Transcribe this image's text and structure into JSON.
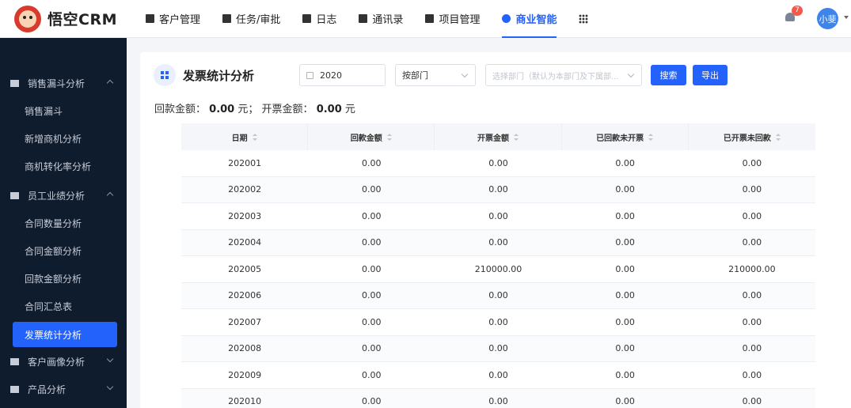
{
  "app": {
    "brand": "悟空CRM"
  },
  "nav": {
    "items": [
      {
        "label": "客户管理"
      },
      {
        "label": "任务/审批"
      },
      {
        "label": "日志"
      },
      {
        "label": "通讯录"
      },
      {
        "label": "项目管理"
      },
      {
        "label": "商业智能",
        "active": true
      }
    ],
    "notifications": "7",
    "user": "小斐"
  },
  "sidebar": {
    "groups": [
      {
        "label": "销售漏斗分析",
        "expanded": true,
        "items": [
          "销售漏斗",
          "新增商机分析",
          "商机转化率分析"
        ]
      },
      {
        "label": "员工业绩分析",
        "expanded": true,
        "items": [
          "合同数量分析",
          "合同金额分析",
          "回款金额分析",
          "合同汇总表",
          "发票统计分析"
        ]
      },
      {
        "label": "客户画像分析",
        "expanded": false
      },
      {
        "label": "产品分析",
        "expanded": false
      }
    ],
    "active_item": "发票统计分析"
  },
  "page": {
    "title": "发票统计分析",
    "year": "2020",
    "group_by": "按部门",
    "dept_placeholder": "选择部门（默认为本部门及下属部...",
    "search_label": "搜索",
    "export_label": "导出",
    "summary": {
      "received_label": "回款金额：",
      "received_value": "0.00",
      "unit1": "元；",
      "invoiced_label": "开票金额：",
      "invoiced_value": "0.00",
      "unit2": "元"
    }
  },
  "table": {
    "columns": [
      "日期",
      "回款金额",
      "开票金额",
      "已回款未开票",
      "已开票未回款"
    ],
    "rows": [
      [
        "202001",
        "0.00",
        "0.00",
        "0.00",
        "0.00"
      ],
      [
        "202002",
        "0.00",
        "0.00",
        "0.00",
        "0.00"
      ],
      [
        "202003",
        "0.00",
        "0.00",
        "0.00",
        "0.00"
      ],
      [
        "202004",
        "0.00",
        "0.00",
        "0.00",
        "0.00"
      ],
      [
        "202005",
        "0.00",
        "210000.00",
        "0.00",
        "210000.00"
      ],
      [
        "202006",
        "0.00",
        "0.00",
        "0.00",
        "0.00"
      ],
      [
        "202007",
        "0.00",
        "0.00",
        "0.00",
        "0.00"
      ],
      [
        "202008",
        "0.00",
        "0.00",
        "0.00",
        "0.00"
      ],
      [
        "202009",
        "0.00",
        "0.00",
        "0.00",
        "0.00"
      ],
      [
        "202010",
        "0.00",
        "0.00",
        "0.00",
        "0.00"
      ]
    ]
  },
  "colors": {
    "accent": "#2362fb",
    "sidebar_bg": "#0f1c2e",
    "badge": "#f5594a"
  }
}
